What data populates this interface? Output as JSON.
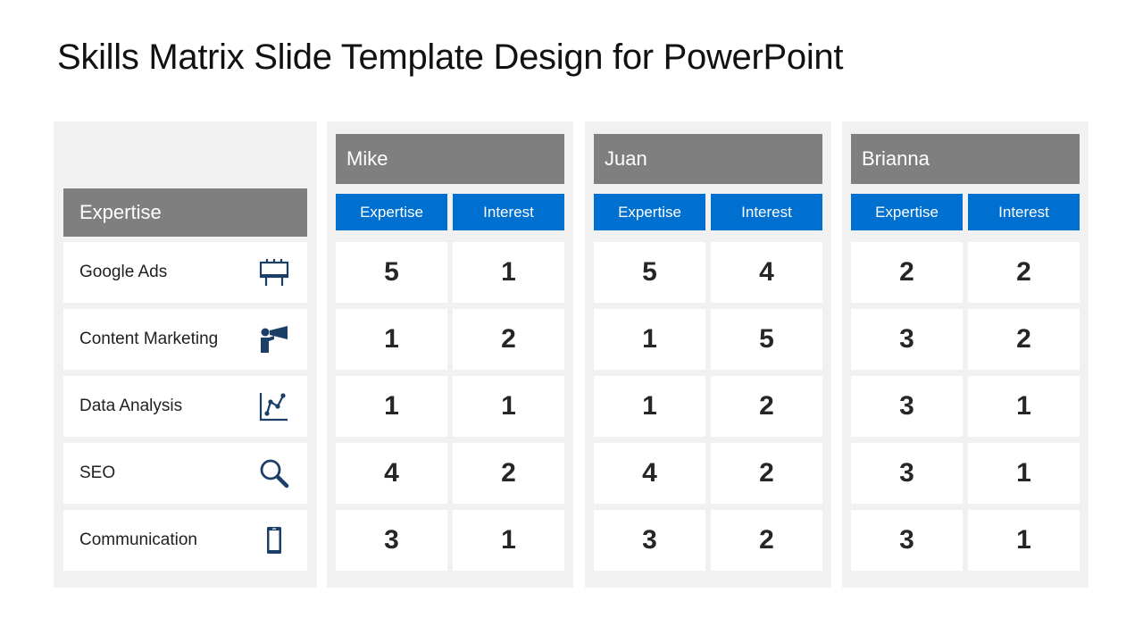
{
  "slide": {
    "title": "Skills Matrix Slide Template Design for PowerPoint"
  },
  "colors": {
    "panel_bg": "#f1f1f1",
    "header_gray": "#7f7f7f",
    "subheader_blue": "#0070d0",
    "icon_navy": "#1b3f66"
  },
  "skills_column": {
    "header": "Expertise",
    "skills": [
      {
        "label": "Google Ads",
        "icon": "billboard-icon"
      },
      {
        "label": "Content Marketing",
        "icon": "megaphone-person-icon"
      },
      {
        "label": "Data Analysis",
        "icon": "line-chart-icon"
      },
      {
        "label": "SEO",
        "icon": "magnifier-icon"
      },
      {
        "label": "Communication",
        "icon": "smartphone-icon"
      }
    ]
  },
  "people": [
    {
      "name": "Mike",
      "columns": [
        "Expertise",
        "Interest"
      ],
      "expertise": [
        5,
        1,
        1,
        4,
        3
      ],
      "interest": [
        1,
        2,
        1,
        2,
        1
      ]
    },
    {
      "name": "Juan",
      "columns": [
        "Expertise",
        "Interest"
      ],
      "expertise": [
        5,
        1,
        1,
        4,
        3
      ],
      "interest": [
        4,
        5,
        2,
        2,
        2
      ]
    },
    {
      "name": "Brianna",
      "columns": [
        "Expertise",
        "Interest"
      ],
      "expertise": [
        2,
        3,
        3,
        3,
        3
      ],
      "interest": [
        2,
        2,
        1,
        1,
        1
      ]
    }
  ]
}
